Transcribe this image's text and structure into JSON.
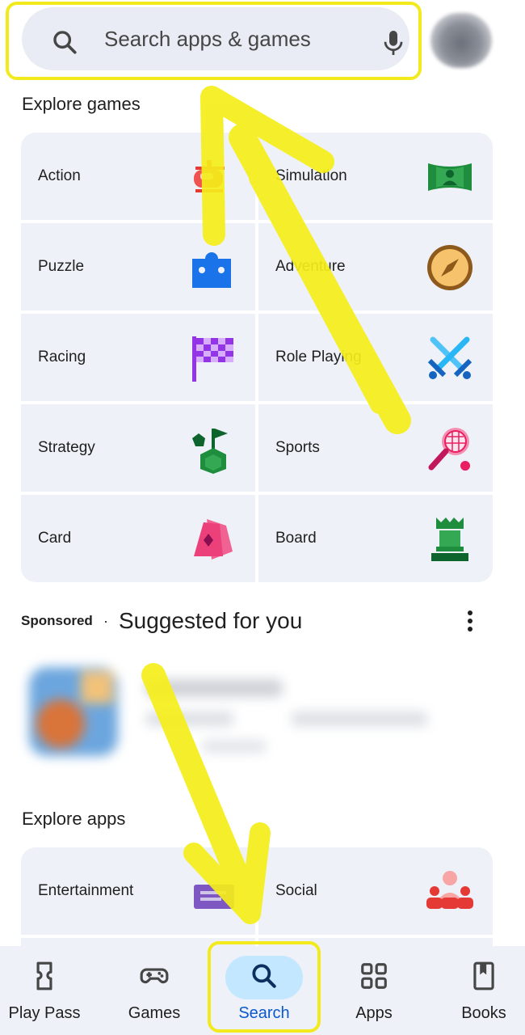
{
  "search": {
    "placeholder": "Search apps & games",
    "search_icon": "search-icon",
    "mic_icon": "mic-icon"
  },
  "explore_games": {
    "title": "Explore games",
    "categories": [
      {
        "label": "Action",
        "icon": "helicopter-icon"
      },
      {
        "label": "Simulation",
        "icon": "panorama-person-icon"
      },
      {
        "label": "Puzzle",
        "icon": "puzzle-piece-icon"
      },
      {
        "label": "Adventure",
        "icon": "compass-icon"
      },
      {
        "label": "Racing",
        "icon": "checkered-flag-icon"
      },
      {
        "label": "Role Playing",
        "icon": "crossed-swords-icon"
      },
      {
        "label": "Strategy",
        "icon": "strategy-flag-icon"
      },
      {
        "label": "Sports",
        "icon": "tennis-racket-icon"
      },
      {
        "label": "Card",
        "icon": "playing-cards-icon"
      },
      {
        "label": "Board",
        "icon": "chess-rook-icon"
      }
    ]
  },
  "suggested": {
    "sponsored_label": "Sponsored",
    "separator": "·",
    "title": "Suggested for you",
    "more_icon": "more-vert-icon"
  },
  "explore_apps": {
    "title": "Explore apps",
    "categories": [
      {
        "label": "Entertainment",
        "icon": "clapperboard-icon"
      },
      {
        "label": "Social",
        "icon": "people-icon"
      }
    ]
  },
  "bottom_nav": {
    "items": [
      {
        "label": "Play Pass",
        "icon": "ticket-icon"
      },
      {
        "label": "Games",
        "icon": "gamepad-icon"
      },
      {
        "label": "Search",
        "icon": "search-icon",
        "selected": true
      },
      {
        "label": "Apps",
        "icon": "apps-grid-icon"
      },
      {
        "label": "Books",
        "icon": "book-icon"
      }
    ]
  },
  "colors": {
    "highlight": "#f2ea1c",
    "selected_pill": "#c2e7ff",
    "selected_label": "#0b57d0",
    "tile_bg": "#eef1f7"
  }
}
